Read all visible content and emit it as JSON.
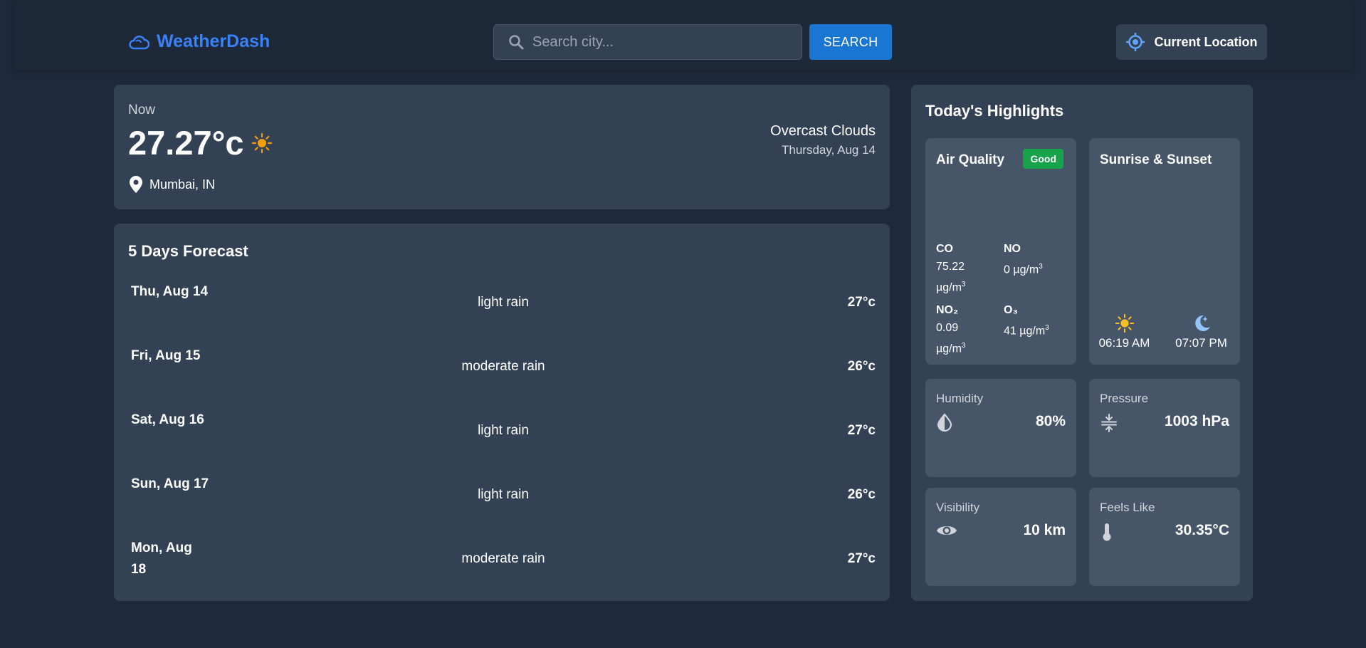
{
  "header": {
    "brand": "WeatherDash",
    "search_placeholder": "Search city...",
    "search_button": "SEARCH",
    "location_button": "Current Location"
  },
  "current": {
    "label": "Now",
    "temperature": "27.27°c",
    "condition": "Overcast Clouds",
    "date": "Thursday, Aug 14",
    "location": "Mumbai, IN"
  },
  "forecast": {
    "title": "5 Days Forecast",
    "days": [
      {
        "day": "Thu, Aug 14",
        "desc": "light rain",
        "temp": "27°c"
      },
      {
        "day": "Fri, Aug 15",
        "desc": "moderate rain",
        "temp": "26°c"
      },
      {
        "day": "Sat, Aug 16",
        "desc": "light rain",
        "temp": "27°c"
      },
      {
        "day": "Sun, Aug 17",
        "desc": "light rain",
        "temp": "26°c"
      },
      {
        "day": "Mon, Aug 18",
        "desc": "moderate rain",
        "temp": "27°c"
      }
    ]
  },
  "highlights": {
    "title": "Today's Highlights",
    "air_quality": {
      "title": "Air Quality",
      "badge": "Good",
      "co_label": "CO",
      "co_value": "75.22",
      "no_label": "NO",
      "no_value": "0",
      "no2_label": "NO₂",
      "no2_value": "0.09",
      "o3_label": "O₃",
      "o3_value": "41",
      "unit": "µg/m",
      "unit_exp": "3"
    },
    "sun": {
      "title": "Sunrise & Sunset",
      "sunrise": "06:19 AM",
      "sunset": "07:07 PM"
    },
    "humidity": {
      "label": "Humidity",
      "value": "80%"
    },
    "pressure": {
      "label": "Pressure",
      "value": "1003 hPa"
    },
    "visibility": {
      "label": "Visibility",
      "value": "10 km"
    },
    "feels_like": {
      "label": "Feels Like",
      "value": "30.35°C"
    }
  },
  "colors": {
    "background": "#1e293b",
    "card": "#334155",
    "tile": "#475569",
    "accent": "#3b82f6",
    "button": "#1976d2",
    "good": "#16a34a",
    "sun": "#f59e0b"
  }
}
